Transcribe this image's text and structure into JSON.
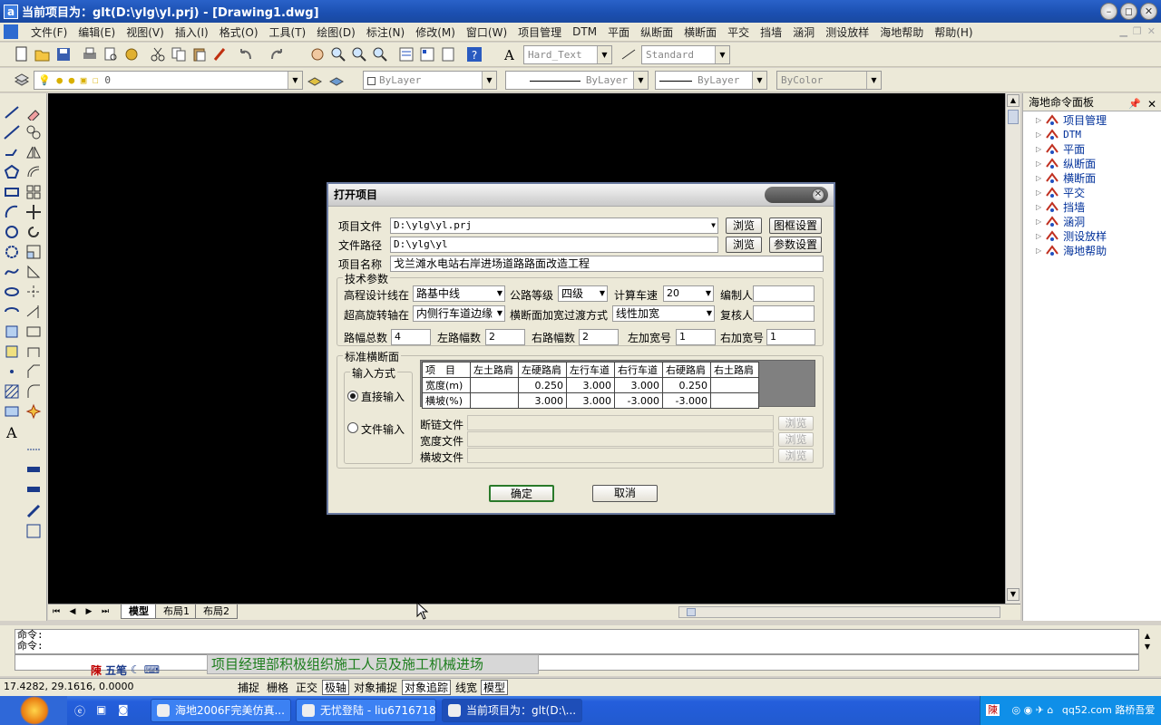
{
  "window": {
    "title": "当前项目为：glt(D:\\ylg\\yl.prj) - [Drawing1.dwg]"
  },
  "menu": [
    "文件(F)",
    "编辑(E)",
    "视图(V)",
    "插入(I)",
    "格式(O)",
    "工具(T)",
    "绘图(D)",
    "标注(N)",
    "修改(M)",
    "窗口(W)",
    "项目管理",
    "DTM",
    "平面",
    "纵断面",
    "横断面",
    "平交",
    "挡墙",
    "涵洞",
    "测设放样",
    "海地帮助",
    "帮助(H)"
  ],
  "toolbar": {
    "text_style": "Hard_Text",
    "dim_style": "Standard",
    "layer": "0",
    "color": "ByLayer",
    "linetype": "ByLayer",
    "lineweight": "ByLayer",
    "plotstyle": "ByColor"
  },
  "right_panel": {
    "title": "海地命令面板",
    "items": [
      "项目管理",
      "DTM",
      "平面",
      "纵断面",
      "横断面",
      "平交",
      "挡墙",
      "涵洞",
      "测设放样",
      "海地帮助"
    ]
  },
  "layout_tabs": [
    "模型",
    "布局1",
    "布局2"
  ],
  "command": {
    "line1": "命令:",
    "line2": "命令:"
  },
  "ime": {
    "text": "五笔"
  },
  "marquee_text": "项目经理部积极组织施工人员及施工机械进场",
  "status": {
    "coords": "17.4282, 29.1616, 0.0000",
    "buttons": [
      {
        "label": "捕捉",
        "on": false
      },
      {
        "label": "栅格",
        "on": false
      },
      {
        "label": "正交",
        "on": false
      },
      {
        "label": "极轴",
        "on": true
      },
      {
        "label": "对象捕捉",
        "on": false
      },
      {
        "label": "对象追踪",
        "on": true
      },
      {
        "label": "线宽",
        "on": false
      },
      {
        "label": "模型",
        "on": true
      }
    ]
  },
  "taskbar": {
    "tasks": [
      "海地2006F完美仿真...",
      "无忧登陆 - liu67167188",
      "当前项目为：glt(D:\\..."
    ],
    "tray_text": "qq52.com 路桥吾爱"
  },
  "dialog": {
    "title": "打开项目",
    "project_file_label": "项目文件",
    "project_file": "D:\\ylg\\yl.prj",
    "file_path_label": "文件路径",
    "file_path": "D:\\ylg\\yl",
    "project_name_label": "项目名称",
    "project_name": "戈兰滩水电站右岸进场道路路面改造工程",
    "browse": "浏览",
    "frame_settings": "图框设置",
    "param_settings": "参数设置",
    "tech_group": "技术参数",
    "elev_line_label": "高程设计线在",
    "elev_line": "路基中线",
    "road_grade_label": "公路等级",
    "road_grade": "四级",
    "speed_label": "计算车速",
    "speed": "20",
    "author_label": "编制人",
    "author": "",
    "super_axis_label": "超高旋转轴在",
    "super_axis": "内侧行车道边缘",
    "widen_label": "横断面加宽过渡方式",
    "widen": "线性加宽",
    "checker_label": "复核人",
    "checker": "",
    "total_lanes_label": "路幅总数",
    "total_lanes": "4",
    "left_lanes_label": "左路幅数",
    "left_lanes": "2",
    "right_lanes_label": "右路幅数",
    "right_lanes": "2",
    "left_widen_label": "左加宽号",
    "left_widen": "1",
    "right_widen_label": "右加宽号",
    "right_widen": "1",
    "std_group": "标准横断面",
    "input_mode_label": "输入方式",
    "direct_input": "直接输入",
    "file_input": "文件输入",
    "chain_file_label": "断链文件",
    "width_file_label": "宽度文件",
    "slope_file_label": "横坡文件",
    "ok": "确定",
    "cancel": "取消",
    "table": {
      "headers": [
        "项　目",
        "左土路肩",
        "左硬路肩",
        "左行车道",
        "右行车道",
        "右硬路肩",
        "右土路肩"
      ],
      "rows": [
        [
          "宽度(m)",
          "",
          "0.250",
          "3.000",
          "3.000",
          "0.250",
          ""
        ],
        [
          "横坡(%)",
          "",
          "3.000",
          "3.000",
          "-3.000",
          "-3.000",
          ""
        ]
      ]
    }
  }
}
